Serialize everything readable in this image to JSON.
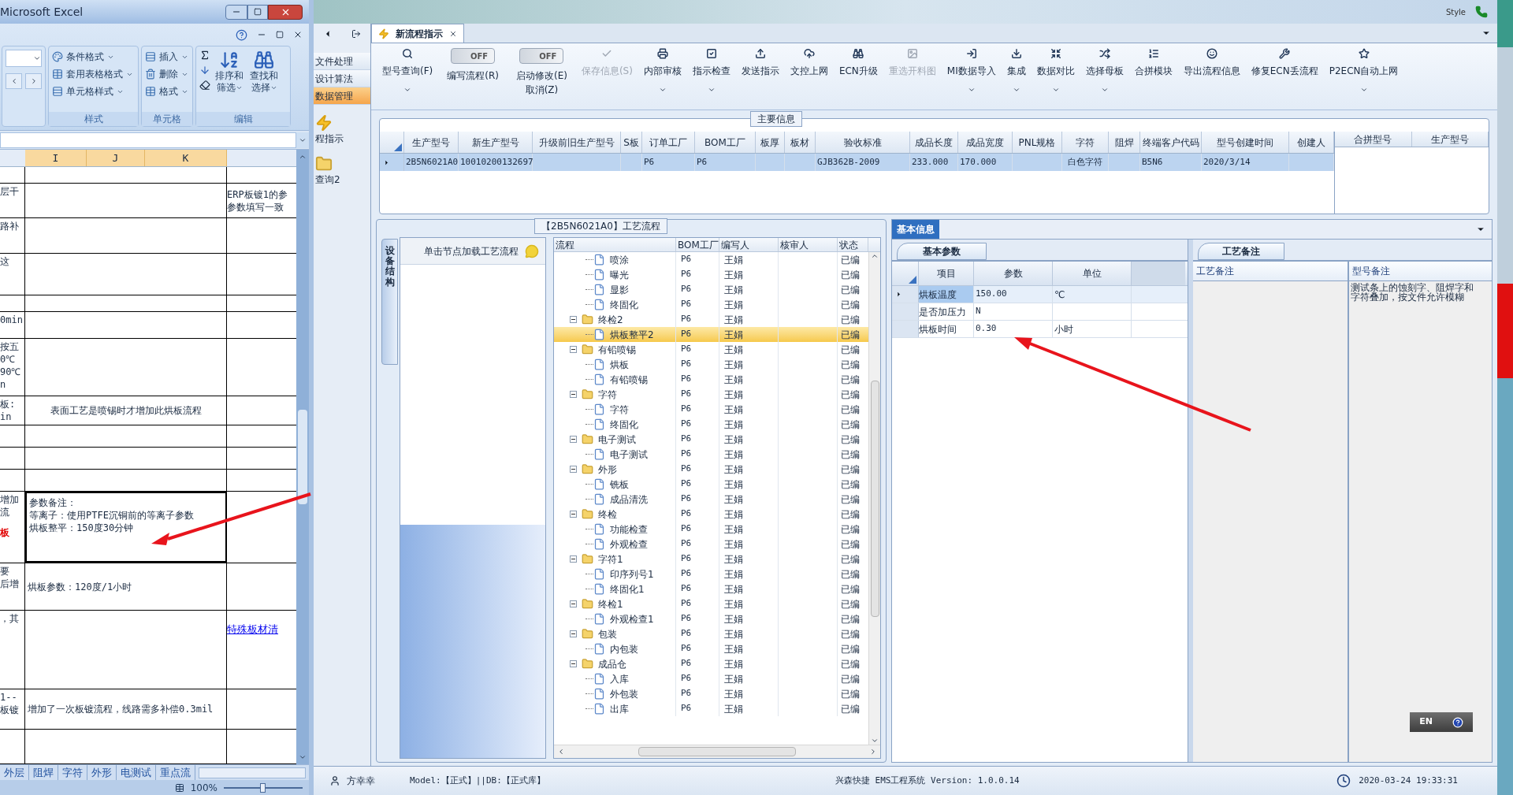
{
  "desktop": {
    "style_label": "Style"
  },
  "excel": {
    "title": "Microsoft Excel",
    "ribbon": {
      "groups": [
        {
          "label": "样式",
          "items": [
            "条件格式",
            "套用表格格式",
            "单元格样式"
          ]
        },
        {
          "label": "单元格",
          "items": [
            "插入",
            "删除",
            "格式"
          ]
        },
        {
          "label": "编辑",
          "big_buttons": [
            {
              "line1": "排序和",
              "line2": "筛选"
            },
            {
              "line1": "查找和",
              "line2": "选择"
            }
          ]
        }
      ]
    },
    "columns": [
      "I",
      "J",
      "K"
    ],
    "rows": [
      {
        "selected": false
      },
      {
        "left": [
          "层干"
        ],
        "right": [
          "ERP板镀1的参",
          "参数填写一致"
        ],
        "selected": false
      },
      {
        "left": [
          "路补"
        ],
        "selected": false
      },
      {
        "left": [
          "这"
        ],
        "selected": false
      },
      {
        "selected": false
      },
      {
        "left": [
          "0min"
        ],
        "selected": false
      },
      {
        "left": [
          "按五",
          "0℃",
          "90℃",
          "n"
        ],
        "selected": false
      },
      {
        "left": [
          "板:",
          "in"
        ],
        "main": [
          "表面工艺是喷锡时才增加此烘板流程"
        ],
        "centered": true,
        "selected": false
      },
      {
        "selected": false
      },
      {
        "selected": false
      },
      {
        "selected": false
      },
      {
        "left": [
          "增加",
          "流"
        ],
        "left_alert": "板",
        "main": [
          "参数备注：",
          "等离子：使用PTFE沉铜前的等离子参数",
          "烘板整平：150度30分钟"
        ],
        "selected": true
      },
      {
        "left": [
          "要",
          "后增"
        ],
        "main": [
          "烘板参数：120度/1小时"
        ],
        "selected": false
      },
      {
        "left": [
          "，其"
        ],
        "right_link": "特殊板材清",
        "selected": false
      },
      {
        "left": [
          "1--",
          "板镀"
        ],
        "main": [
          "增加了一次板镀流程，线路需多补偿0.3mil"
        ],
        "selected": false
      },
      {
        "selected": false
      }
    ],
    "sheet_tabs": [
      "外层",
      "阻焊",
      "字符",
      "外形",
      "电测试",
      "重点流"
    ],
    "zoom": "100%",
    "zoom_slider": {
      "level": 0.5
    }
  },
  "sidebar": {
    "items": [
      {
        "label": "文件处理",
        "selected": false
      },
      {
        "label": "设计算法",
        "selected": false
      },
      {
        "label": "数据管理",
        "selected": true
      }
    ],
    "shortcuts": [
      {
        "label": "程指示"
      },
      {
        "label": "查询2"
      }
    ]
  },
  "tab": {
    "label": "新流程指示"
  },
  "toolbar": [
    {
      "kind": "button",
      "label": "型号查询(F)",
      "dropdown": true,
      "disabled": false
    },
    {
      "kind": "toggle",
      "label": "编写流程(R)",
      "toggle_text": "OFF",
      "on": false
    },
    {
      "kind": "toggle",
      "label": "启动修改(E)",
      "label2": "取消(Z)",
      "toggle_text": "OFF",
      "on": false
    },
    {
      "kind": "button",
      "label": "保存信息(S)",
      "dropdown": false,
      "disabled": true
    },
    {
      "kind": "button",
      "label": "内部审核",
      "dropdown": true,
      "disabled": false
    },
    {
      "kind": "button",
      "label": "指示检查",
      "dropdown": true,
      "disabled": false
    },
    {
      "kind": "button",
      "label": "发送指示",
      "dropdown": false,
      "disabled": false
    },
    {
      "kind": "button",
      "label": "文控上网",
      "dropdown": false,
      "disabled": false
    },
    {
      "kind": "button",
      "label": "ECN升级",
      "dropdown": false,
      "disabled": false
    },
    {
      "kind": "button",
      "label": "重选开料图",
      "dropdown": false,
      "disabled": true
    },
    {
      "kind": "button",
      "label": "MI数据导入",
      "dropdown": true,
      "disabled": false
    },
    {
      "kind": "button",
      "label": "集成",
      "dropdown": true,
      "disabled": false
    },
    {
      "kind": "button",
      "label": "数据对比",
      "dropdown": true,
      "disabled": false
    },
    {
      "kind": "button",
      "label": "选择母板",
      "dropdown": true,
      "disabled": false
    },
    {
      "kind": "button",
      "label": "合拼模块",
      "dropdown": false,
      "disabled": false
    },
    {
      "kind": "button",
      "label": "导出流程信息",
      "dropdown": false,
      "disabled": false
    },
    {
      "kind": "button",
      "label": "修复ECN丢流程",
      "dropdown": false,
      "disabled": false
    },
    {
      "kind": "button",
      "label": "P2ECN自动上网",
      "dropdown": true,
      "disabled": false
    }
  ],
  "main_info": {
    "title": "主要信息",
    "columns": [
      "生产型号",
      "新生产型号",
      "升级前旧生产型号",
      "S板",
      "订单工厂",
      "BOM工厂",
      "板厚",
      "板材",
      "验收标准",
      "成品长度",
      "成品宽度",
      "PNL规格",
      "字符",
      "阻焊",
      "终端客户代码",
      "型号创建时间",
      "创建人"
    ],
    "rows": [
      {
        "cells": [
          "2B5N6021A0",
          "10010200132697",
          null,
          null,
          "P6",
          "P6",
          null,
          null,
          "GJB362B-2009",
          "233.000",
          "170.000",
          null,
          "白色字符",
          null,
          "B5N6",
          "2020/3/14",
          null
        ],
        "selected": true
      }
    ],
    "side_columns": [
      "合拼型号",
      "生产型号"
    ]
  },
  "flow_panel": {
    "title": "【2B5N6021A0】工艺流程",
    "side_tab": "设备结构",
    "hint": "单击节点加载工艺流程",
    "columns": [
      "流程",
      "BOM工厂",
      "编写人",
      "核审人",
      "状态"
    ],
    "tree": [
      {
        "children": [
          {
            "label": "喷涂",
            "bom": "P6",
            "writer": "王娟",
            "status": "已编",
            "selected": false
          },
          {
            "label": "曝光",
            "bom": "P6",
            "writer": "王娟",
            "status": "已编",
            "selected": false
          },
          {
            "label": "显影",
            "bom": "P6",
            "writer": "王娟",
            "status": "已编",
            "selected": false
          },
          {
            "label": "终固化",
            "bom": "P6",
            "writer": "王娟",
            "status": "已编",
            "selected": false
          }
        ]
      },
      {
        "label": "终检2",
        "bom": "P6",
        "writer": "王娟",
        "status": "已编",
        "selected": false,
        "expanded": true,
        "children": [
          {
            "label": "烘板整平2",
            "bom": "P6",
            "writer": "王娟",
            "status": "已编",
            "selected": true
          }
        ]
      },
      {
        "label": "有铅喷锡",
        "bom": "P6",
        "writer": "王娟",
        "status": "已编",
        "selected": false,
        "expanded": true,
        "children": [
          {
            "label": "烘板",
            "bom": "P6",
            "writer": "王娟",
            "status": "已编",
            "selected": false
          },
          {
            "label": "有铅喷锡",
            "bom": "P6",
            "writer": "王娟",
            "status": "已编",
            "selected": false
          }
        ]
      },
      {
        "label": "字符",
        "bom": "P6",
        "writer": "王娟",
        "status": "已编",
        "selected": false,
        "expanded": true,
        "children": [
          {
            "label": "字符",
            "bom": "P6",
            "writer": "王娟",
            "status": "已编",
            "selected": false
          },
          {
            "label": "终固化",
            "bom": "P6",
            "writer": "王娟",
            "status": "已编",
            "selected": false
          }
        ]
      },
      {
        "label": "电子测试",
        "bom": "P6",
        "writer": "王娟",
        "status": "已编",
        "selected": false,
        "expanded": true,
        "children": [
          {
            "label": "电子测试",
            "bom": "P6",
            "writer": "王娟",
            "status": "已编",
            "selected": false
          }
        ]
      },
      {
        "label": "外形",
        "bom": "P6",
        "writer": "王娟",
        "status": "已编",
        "selected": false,
        "expanded": true,
        "children": [
          {
            "label": "铣板",
            "bom": "P6",
            "writer": "王娟",
            "status": "已编",
            "selected": false
          },
          {
            "label": "成品清洗",
            "bom": "P6",
            "writer": "王娟",
            "status": "已编",
            "selected": false
          }
        ]
      },
      {
        "label": "终检",
        "bom": "P6",
        "writer": "王娟",
        "status": "已编",
        "selected": false,
        "expanded": true,
        "children": [
          {
            "label": "功能检查",
            "bom": "P6",
            "writer": "王娟",
            "status": "已编",
            "selected": false
          },
          {
            "label": "外观检查",
            "bom": "P6",
            "writer": "王娟",
            "status": "已编",
            "selected": false
          }
        ]
      },
      {
        "label": "字符1",
        "bom": "P6",
        "writer": "王娟",
        "status": "已编",
        "selected": false,
        "expanded": true,
        "children": [
          {
            "label": "印序列号1",
            "bom": "P6",
            "writer": "王娟",
            "status": "已编",
            "selected": false
          },
          {
            "label": "终固化1",
            "bom": "P6",
            "writer": "王娟",
            "status": "已编",
            "selected": false
          }
        ]
      },
      {
        "label": "终检1",
        "bom": "P6",
        "writer": "王娟",
        "status": "已编",
        "selected": false,
        "expanded": true,
        "children": [
          {
            "label": "外观检查1",
            "bom": "P6",
            "writer": "王娟",
            "status": "已编",
            "selected": false
          }
        ]
      },
      {
        "label": "包装",
        "bom": "P6",
        "writer": "王娟",
        "status": "已编",
        "selected": false,
        "expanded": true,
        "children": [
          {
            "label": "内包装",
            "bom": "P6",
            "writer": "王娟",
            "status": "已编",
            "selected": false
          }
        ]
      },
      {
        "label": "成品仓",
        "bom": "P6",
        "writer": "王娟",
        "status": "已编",
        "selected": false,
        "expanded": true,
        "children": [
          {
            "label": "入库",
            "bom": "P6",
            "writer": "王娟",
            "status": "已编",
            "selected": false
          },
          {
            "label": "外包装",
            "bom": "P6",
            "writer": "王娟",
            "status": "已编",
            "selected": false
          },
          {
            "label": "出库",
            "bom": "P6",
            "writer": "王娟",
            "status": "已编",
            "selected": false
          }
        ]
      }
    ]
  },
  "info_panel": {
    "tab": "基本信息",
    "params": {
      "tab": "基本参数",
      "columns": [
        "项目",
        "参数",
        "单位"
      ],
      "rows": [
        {
          "item": "烘板温度",
          "value": "150.00",
          "unit": "℃",
          "selected": true
        },
        {
          "item": "是否加压力",
          "value": "N",
          "selected": false
        },
        {
          "item": "烘板时间",
          "value": "0.30",
          "unit": "小时",
          "selected": false
        }
      ]
    },
    "notes": {
      "tab": "工艺备注",
      "columns": [
        "工艺备注",
        "型号备注"
      ],
      "model_note": "测试条上的蚀刻字、阻焊字和字符叠加，按文件允许模糊"
    },
    "ime": {
      "lang": "EN"
    }
  },
  "status_bar": {
    "user": "方幸幸",
    "model": "Model:【正式】||DB:【正式库】",
    "system": "兴森快捷 EMS工程系统 Version: 1.0.0.14",
    "datetime": "2020-03-24 19:33:31"
  }
}
